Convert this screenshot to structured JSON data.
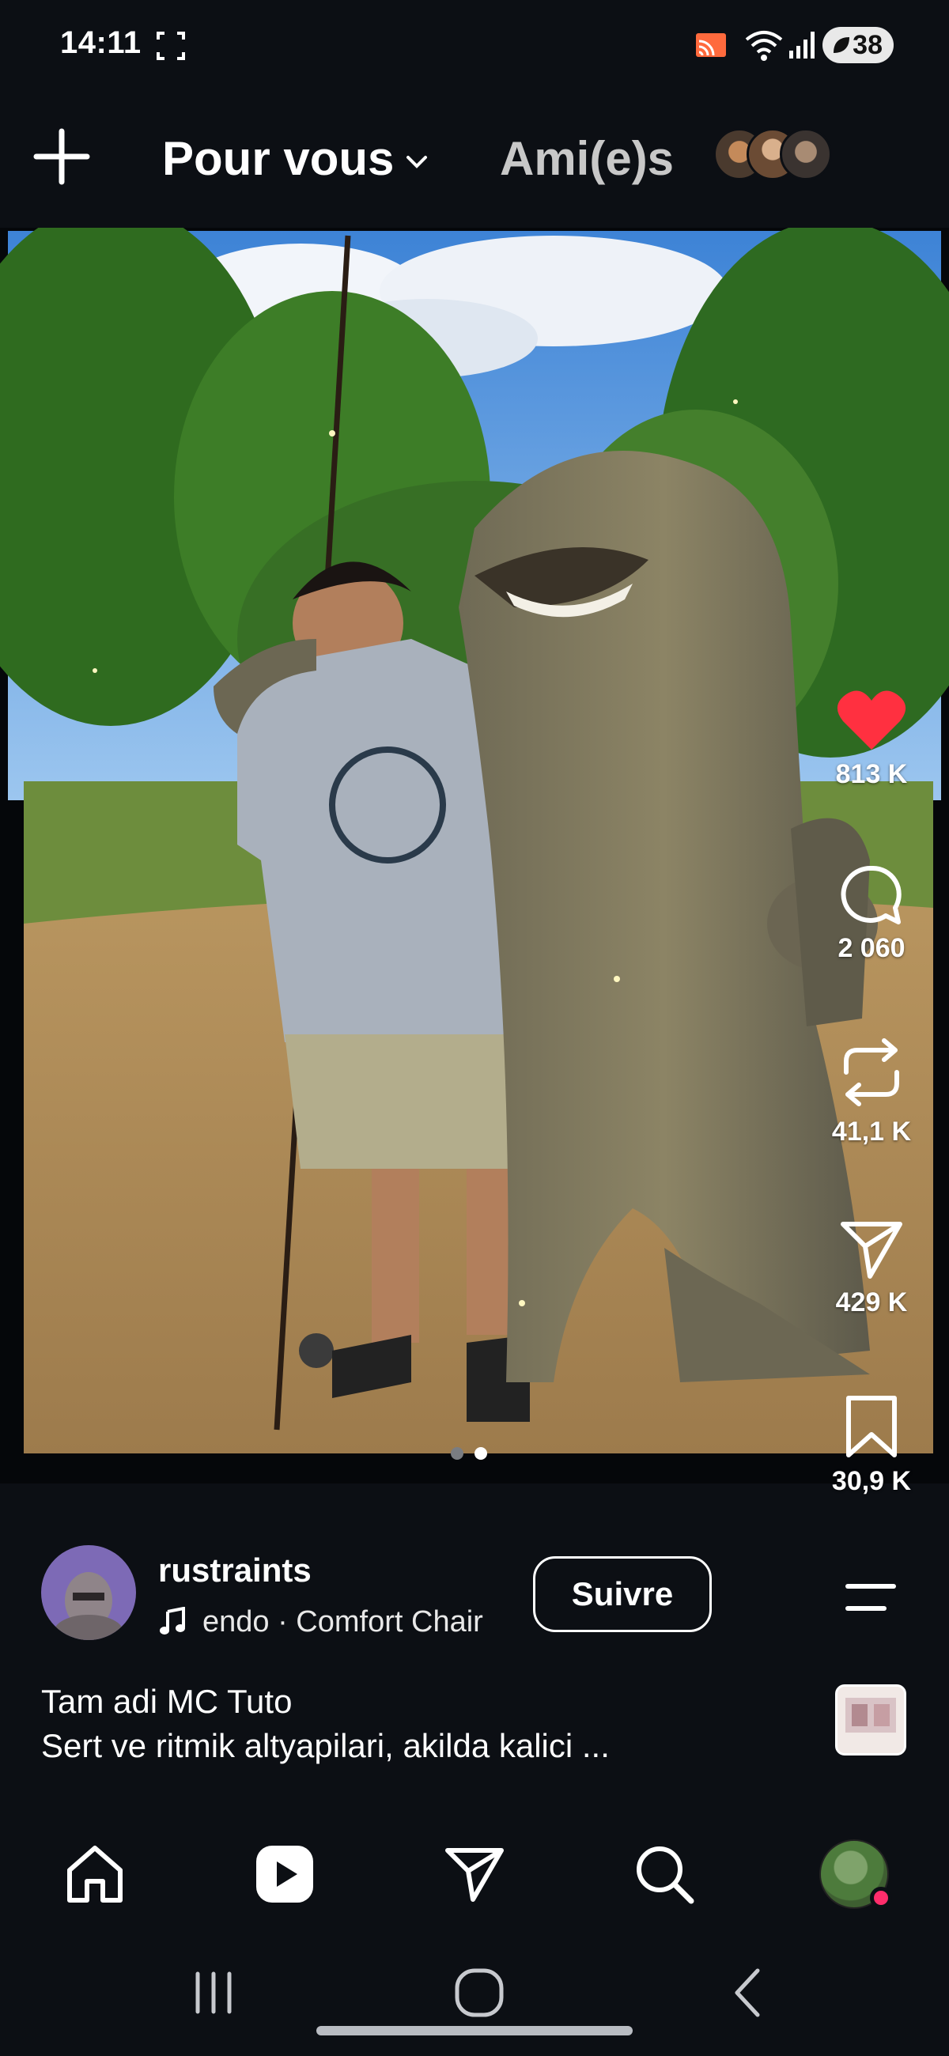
{
  "status_bar": {
    "time": "14:11",
    "battery_level": "38",
    "icons": [
      "screenshot-icon",
      "cast-icon",
      "wifi-icon",
      "signal-icon",
      "battery-saver-icon"
    ]
  },
  "top_nav": {
    "add_icon": "plus-icon",
    "tab_selected_label": "Pour vous",
    "tab_other_label": "Ami(e)s"
  },
  "post": {
    "carousel": {
      "total": 2,
      "active_index": 1
    },
    "actions": {
      "likes": "813 K",
      "comments": "2 060",
      "reposts": "41,1 K",
      "shares": "429 K",
      "saves": "30,9 K",
      "like_color": "#ff3040"
    },
    "author": {
      "username": "rustraints",
      "music": "endo · Comfort Chair",
      "follow_label": "Suivre"
    },
    "caption": {
      "line1": "Tam adi MC Tuto",
      "line2": "Sert ve ritmik altyapilari, akilda kalici ..."
    }
  },
  "bottom_nav": {
    "items": [
      "home-icon",
      "reels-icon",
      "direct-message-icon",
      "search-icon",
      "profile-avatar"
    ]
  },
  "system_nav": {
    "items": [
      "recent-apps-icon",
      "home-circle-icon",
      "back-icon"
    ]
  }
}
